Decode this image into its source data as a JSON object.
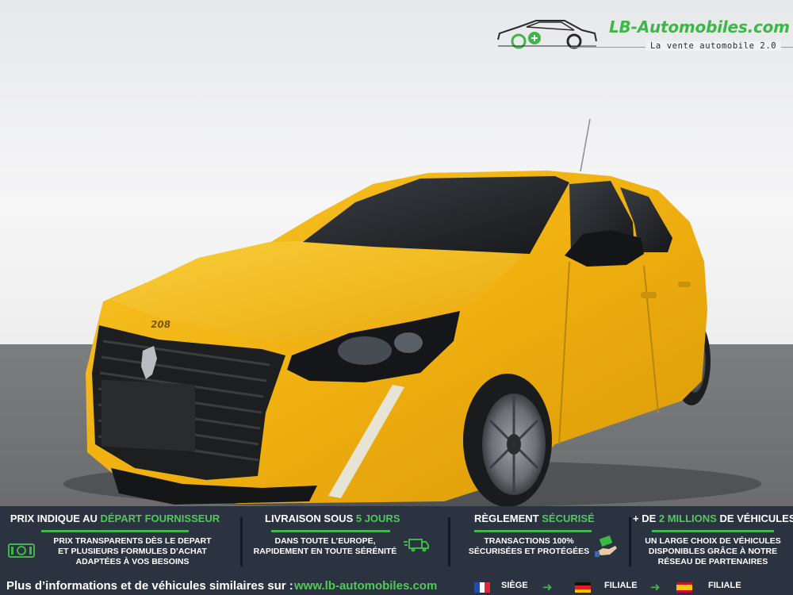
{
  "brand": {
    "name": "LB-Automobiles.com",
    "tagline": "La vente automobile 2.0",
    "logo_icon": "car-outline-icon"
  },
  "vehicle": {
    "badge": "208",
    "body_color": "#f2b413"
  },
  "features": [
    {
      "title_prefix": "PRIX INDIQUE AU ",
      "title_highlight": "DÉPART FOURNISSEUR",
      "title_suffix": "",
      "text": "PRIX TRANSPARENTS DÈS LE DEPART\nET PLUSIEURS FORMULES D’ACHAT\nADAPTÉES À VOS BESOINS",
      "icon": "banknote-icon"
    },
    {
      "title_prefix": "LIVRAISON SOUS ",
      "title_highlight": "5 JOURS",
      "title_suffix": "",
      "text": "DANS TOUTE L’EUROPE,\nRAPIDEMENT EN TOUTE SÉRÉNITÉ",
      "icon": "delivery-truck-icon"
    },
    {
      "title_prefix": "RÈGLEMENT ",
      "title_highlight": "SÉCURISÉ",
      "title_suffix": "",
      "text": "TRANSACTIONS 100%\nSÉCURISÉES ET PROTÉGÉES",
      "icon": "hand-payment-icon"
    },
    {
      "title_prefix": "+ DE ",
      "title_highlight": "2 MILLIONS",
      "title_suffix": " DE VÉHICULES",
      "text": "UN LARGE CHOIX DE VÉHICULES\nDISPONIBLES GRÂCE À NOTRE\nRÉSEAU DE PARTENAIRES",
      "icon": ""
    }
  ],
  "footer": {
    "text": "Plus d’informations et de véhicules similaires sur :",
    "link": "www.lb-automobiles.com",
    "locations": [
      {
        "flag": "france-flag-icon",
        "label": "SIÈGE"
      },
      {
        "flag": "germany-flag-icon",
        "label": "FILIALE"
      },
      {
        "flag": "spain-flag-icon",
        "label": "FILIALE"
      }
    ]
  },
  "colors": {
    "accent_green": "#3fb648",
    "panel_bg": "#2c3340",
    "car_yellow": "#f2b413"
  }
}
